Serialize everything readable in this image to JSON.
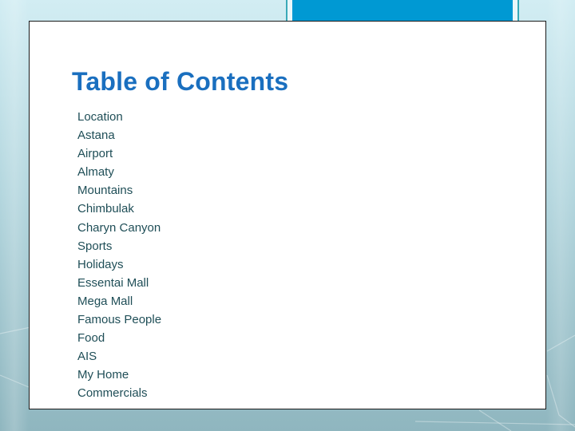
{
  "slide": {
    "title": "Table of Contents",
    "items": [
      "Location",
      "Astana",
      "Airport",
      "Almaty",
      "Mountains",
      "Chimbulak",
      "Charyn Canyon",
      "Sports",
      "Holidays",
      "Essentai Mall",
      "Mega Mall",
      "Famous People",
      "Food",
      "AIS",
      "My Home",
      "Commercials"
    ]
  },
  "colors": {
    "title": "#1a6fbf",
    "body_text": "#1f4e57",
    "accent_blue": "#0099d3",
    "accent_border": "#3aa9b8",
    "background_top": "#d2edf3",
    "background_bottom": "#8fb6bf"
  }
}
